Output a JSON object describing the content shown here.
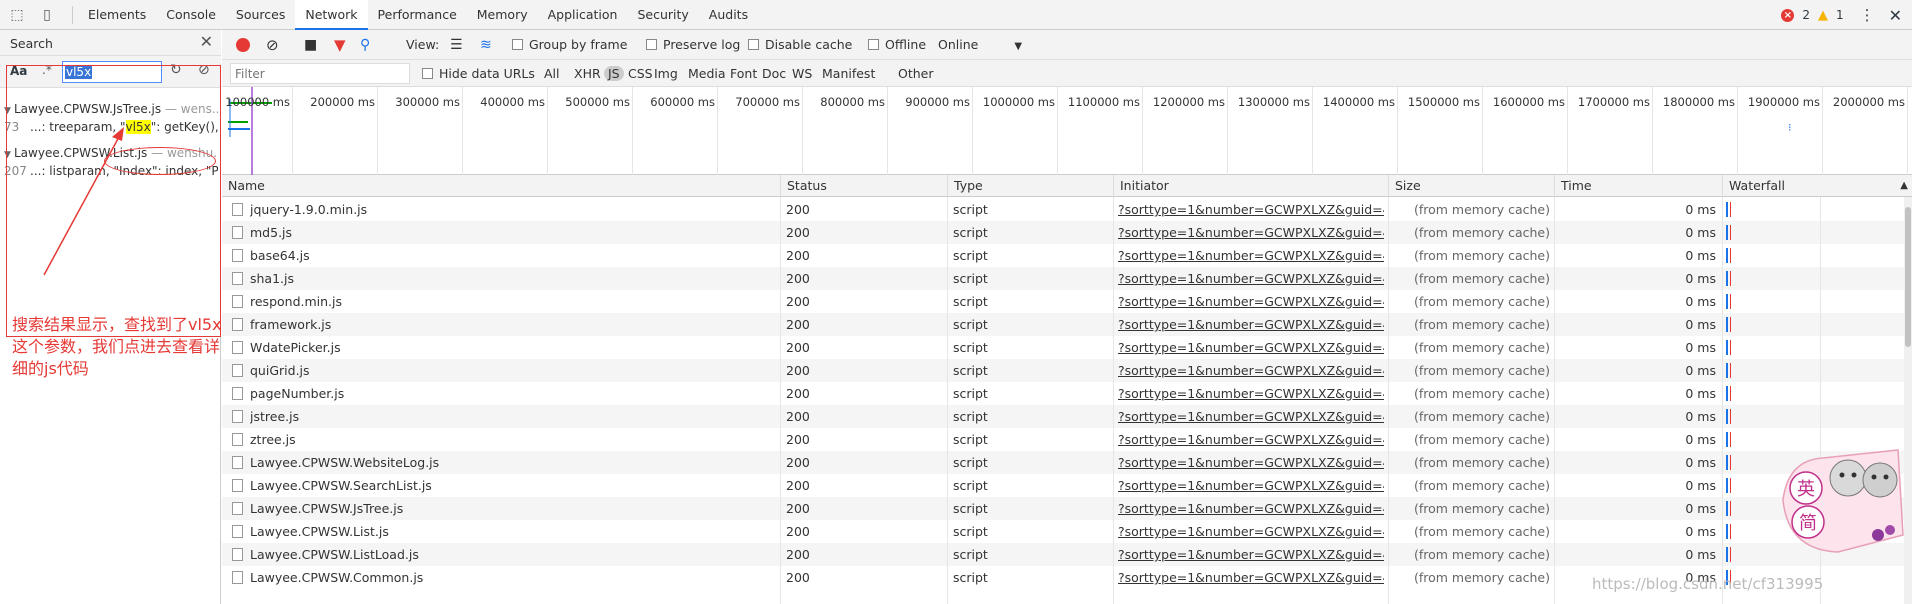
{
  "tabs": [
    "Elements",
    "Console",
    "Sources",
    "Network",
    "Performance",
    "Memory",
    "Application",
    "Security",
    "Audits"
  ],
  "active_tab": "Network",
  "status": {
    "errors": "2",
    "warnings": "1"
  },
  "search": {
    "title": "Search",
    "case_label": "Aa",
    "regex_label": ".*",
    "query": "vl5x",
    "results": [
      {
        "file": "Lawyee.CPWSW.JsTree.js",
        "path": "— wens...",
        "line_no": "73",
        "pre": "...: treeparam, \"",
        "match": "vl5x",
        "post": "\": getKey(),"
      },
      {
        "file": "Lawyee.CPWSW.List.js",
        "path": "— wenshu...",
        "line_no": "207",
        "pre": "...: listparam, \"Index\": index, \"P...",
        "match": "",
        "post": ""
      }
    ]
  },
  "annotation": "搜索结果显示，查找到了vl5x这个参数，我们点进去查看详细的js代码",
  "toolbar": {
    "view_label": "View:",
    "group_by_frame": "Group by frame",
    "preserve_log": "Preserve log",
    "disable_cache": "Disable cache",
    "offline": "Offline",
    "throttle": "Online"
  },
  "filter": {
    "placeholder": "Filter",
    "hide_data_urls": "Hide data URLs",
    "types": [
      "All",
      "XHR",
      "JS",
      "CSS",
      "Img",
      "Media",
      "Font",
      "Doc",
      "WS",
      "Manifest",
      "Other"
    ],
    "selected_type": "JS"
  },
  "overview_ticks": [
    "100000 ms",
    "200000 ms",
    "300000 ms",
    "400000 ms",
    "500000 ms",
    "600000 ms",
    "700000 ms",
    "800000 ms",
    "900000 ms",
    "1000000 ms",
    "1100000 ms",
    "1200000 ms",
    "1300000 ms",
    "1400000 ms",
    "1500000 ms",
    "1600000 ms",
    "1700000 ms",
    "1800000 ms",
    "1900000 ms",
    "2000000 ms"
  ],
  "columns": {
    "name": "Name",
    "status": "Status",
    "type": "Type",
    "initiator": "Initiator",
    "size": "Size",
    "time": "Time",
    "waterfall": "Waterfall"
  },
  "rows": [
    {
      "name": "jquery-1.9.0.min.js",
      "status": "200",
      "type": "script",
      "initiator": "?sorttype=1&number=GCWPXLXZ&guid=4...",
      "size": "(from memory cache)",
      "time": "0 ms"
    },
    {
      "name": "md5.js",
      "status": "200",
      "type": "script",
      "initiator": "?sorttype=1&number=GCWPXLXZ&guid=4...",
      "size": "(from memory cache)",
      "time": "0 ms"
    },
    {
      "name": "base64.js",
      "status": "200",
      "type": "script",
      "initiator": "?sorttype=1&number=GCWPXLXZ&guid=4...",
      "size": "(from memory cache)",
      "time": "0 ms"
    },
    {
      "name": "sha1.js",
      "status": "200",
      "type": "script",
      "initiator": "?sorttype=1&number=GCWPXLXZ&guid=4...",
      "size": "(from memory cache)",
      "time": "0 ms"
    },
    {
      "name": "respond.min.js",
      "status": "200",
      "type": "script",
      "initiator": "?sorttype=1&number=GCWPXLXZ&guid=4...",
      "size": "(from memory cache)",
      "time": "0 ms"
    },
    {
      "name": "framework.js",
      "status": "200",
      "type": "script",
      "initiator": "?sorttype=1&number=GCWPXLXZ&guid=4...",
      "size": "(from memory cache)",
      "time": "0 ms"
    },
    {
      "name": "WdatePicker.js",
      "status": "200",
      "type": "script",
      "initiator": "?sorttype=1&number=GCWPXLXZ&guid=4...",
      "size": "(from memory cache)",
      "time": "0 ms"
    },
    {
      "name": "quiGrid.js",
      "status": "200",
      "type": "script",
      "initiator": "?sorttype=1&number=GCWPXLXZ&guid=4...",
      "size": "(from memory cache)",
      "time": "0 ms"
    },
    {
      "name": "pageNumber.js",
      "status": "200",
      "type": "script",
      "initiator": "?sorttype=1&number=GCWPXLXZ&guid=4...",
      "size": "(from memory cache)",
      "time": "0 ms"
    },
    {
      "name": "jstree.js",
      "status": "200",
      "type": "script",
      "initiator": "?sorttype=1&number=GCWPXLXZ&guid=4...",
      "size": "(from memory cache)",
      "time": "0 ms"
    },
    {
      "name": "ztree.js",
      "status": "200",
      "type": "script",
      "initiator": "?sorttype=1&number=GCWPXLXZ&guid=4...",
      "size": "(from memory cache)",
      "time": "0 ms"
    },
    {
      "name": "Lawyee.CPWSW.WebsiteLog.js",
      "status": "200",
      "type": "script",
      "initiator": "?sorttype=1&number=GCWPXLXZ&guid=4...",
      "size": "(from memory cache)",
      "time": "0 ms"
    },
    {
      "name": "Lawyee.CPWSW.SearchList.js",
      "status": "200",
      "type": "script",
      "initiator": "?sorttype=1&number=GCWPXLXZ&guid=4...",
      "size": "(from memory cache)",
      "time": "0 ms"
    },
    {
      "name": "Lawyee.CPWSW.JsTree.js",
      "status": "200",
      "type": "script",
      "initiator": "?sorttype=1&number=GCWPXLXZ&guid=4...",
      "size": "(from memory cache)",
      "time": "0 ms"
    },
    {
      "name": "Lawyee.CPWSW.List.js",
      "status": "200",
      "type": "script",
      "initiator": "?sorttype=1&number=GCWPXLXZ&guid=4...",
      "size": "(from memory cache)",
      "time": "0 ms"
    },
    {
      "name": "Lawyee.CPWSW.ListLoad.js",
      "status": "200",
      "type": "script",
      "initiator": "?sorttype=1&number=GCWPXLXZ&guid=4...",
      "size": "(from memory cache)",
      "time": "0 ms"
    },
    {
      "name": "Lawyee.CPWSW.Common.js",
      "status": "200",
      "type": "script",
      "initiator": "?sorttype=1&number=GCWPXLXZ&guid=4...",
      "size": "(from memory cache)",
      "time": "0 ms"
    }
  ],
  "watermark": "https://blog.csdn.net/cf313995",
  "sticker_text": [
    "英",
    "简"
  ]
}
